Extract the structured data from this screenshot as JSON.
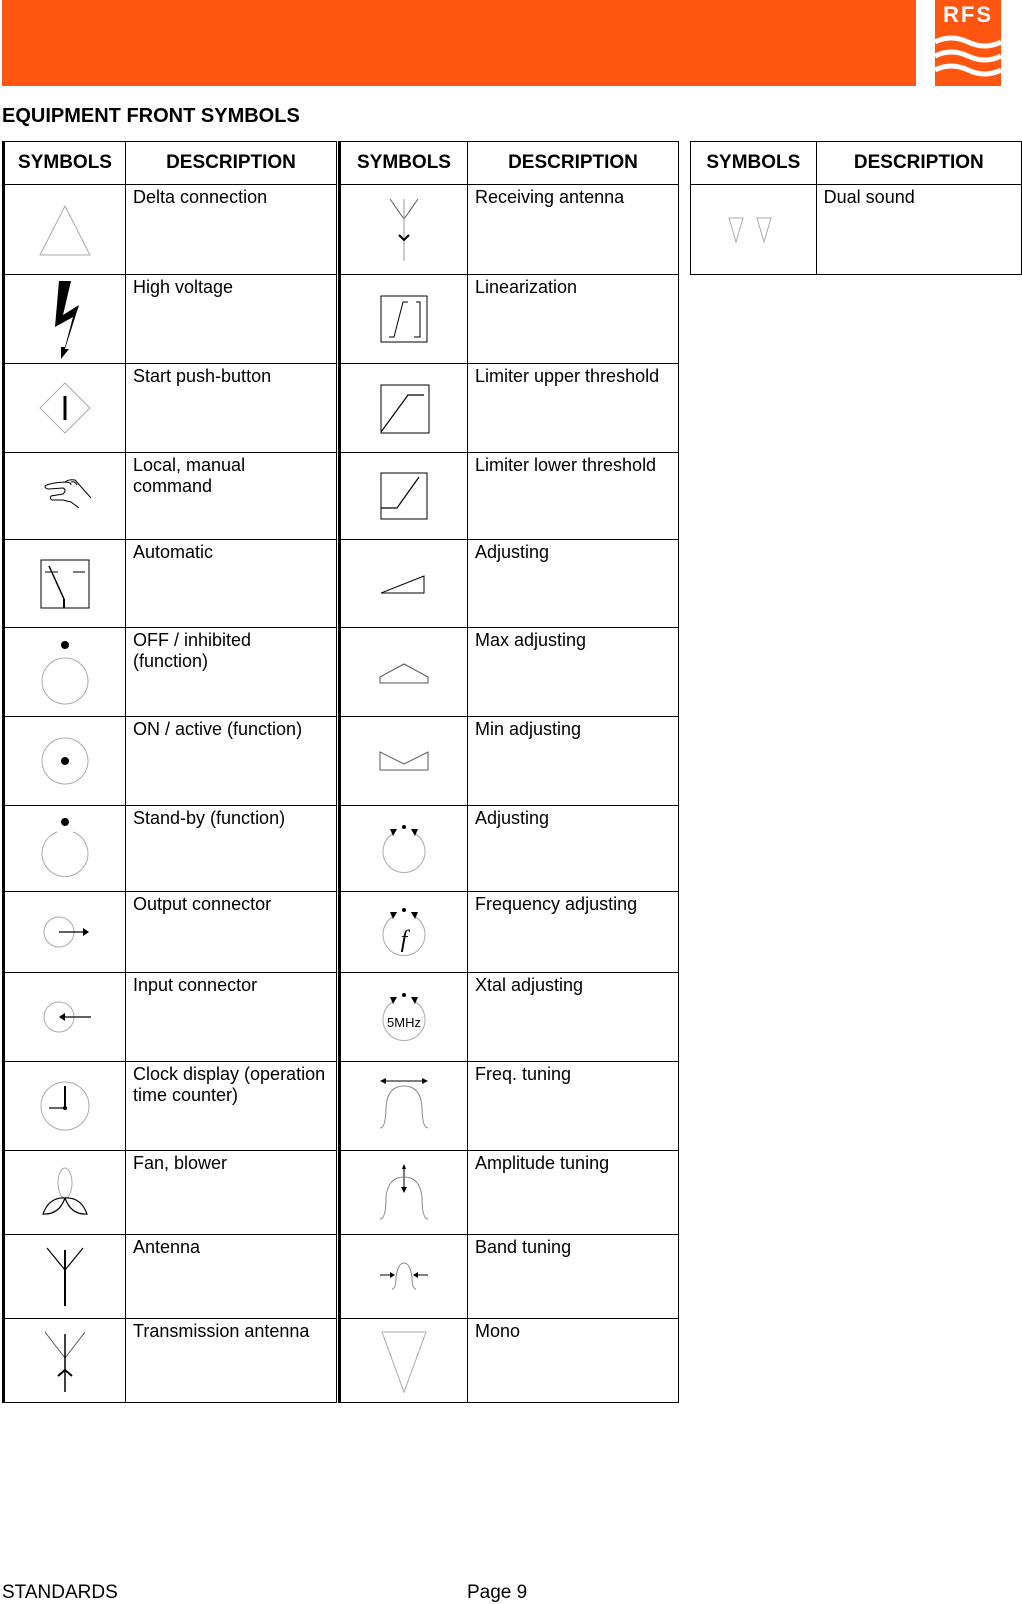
{
  "header": {
    "brand_color": "#fe5511",
    "logo_text": "RFS"
  },
  "page_title": "EQUIPMENT FRONT SYMBOLS",
  "table_headers": {
    "symbols": "SYMBOLS",
    "description": "DESCRIPTION"
  },
  "tables": [
    {
      "rows": [
        {
          "icon": "delta-connection-icon",
          "description": "Delta connection"
        },
        {
          "icon": "high-voltage-icon",
          "description": "High voltage"
        },
        {
          "icon": "start-push-button-icon",
          "description": "Start push-button"
        },
        {
          "icon": "hand-icon",
          "description": "Local, manual command"
        },
        {
          "icon": "automatic-switch-icon",
          "description": "Automatic"
        },
        {
          "icon": "off-inhibited-icon",
          "description": "OFF / inhibited (function)"
        },
        {
          "icon": "on-active-icon",
          "description": "ON / active (function)"
        },
        {
          "icon": "standby-icon",
          "description": "Stand-by (function)"
        },
        {
          "icon": "output-connector-icon",
          "description": "Output connector"
        },
        {
          "icon": "input-connector-icon",
          "description": "Input connector"
        },
        {
          "icon": "clock-icon",
          "description": "Clock display (operation time counter)"
        },
        {
          "icon": "fan-icon",
          "description": "Fan, blower"
        },
        {
          "icon": "antenna-icon",
          "description": "Antenna"
        },
        {
          "icon": "transmission-antenna-icon",
          "description": "Transmission antenna"
        }
      ]
    },
    {
      "rows": [
        {
          "icon": "receiving-antenna-icon",
          "description": "Receiving antenna"
        },
        {
          "icon": "linearization-icon",
          "description": "Linearization"
        },
        {
          "icon": "limiter-upper-icon",
          "description": "Limiter upper threshold"
        },
        {
          "icon": "limiter-lower-icon",
          "description": "Limiter lower threshold"
        },
        {
          "icon": "adjusting-ramp-icon",
          "description": "Adjusting"
        },
        {
          "icon": "max-adjusting-icon",
          "description": "Max adjusting"
        },
        {
          "icon": "min-adjusting-icon",
          "description": "Min adjusting"
        },
        {
          "icon": "adjusting-knob-icon",
          "description": "Adjusting"
        },
        {
          "icon": "frequency-adjusting-icon",
          "description": "Frequency adjusting",
          "glyph": "f"
        },
        {
          "icon": "xtal-adjusting-icon",
          "description": "Xtal adjusting",
          "glyph": "5MHz"
        },
        {
          "icon": "freq-tuning-icon",
          "description": "Freq. tuning"
        },
        {
          "icon": "amplitude-tuning-icon",
          "description": "Amplitude tuning"
        },
        {
          "icon": "band-tuning-icon",
          "description": "Band tuning"
        },
        {
          "icon": "mono-icon",
          "description": "Mono"
        }
      ]
    },
    {
      "rows": [
        {
          "icon": "dual-sound-icon",
          "description": "Dual sound"
        }
      ]
    }
  ],
  "footer": {
    "left": "STANDARDS",
    "page": "Page 9"
  }
}
